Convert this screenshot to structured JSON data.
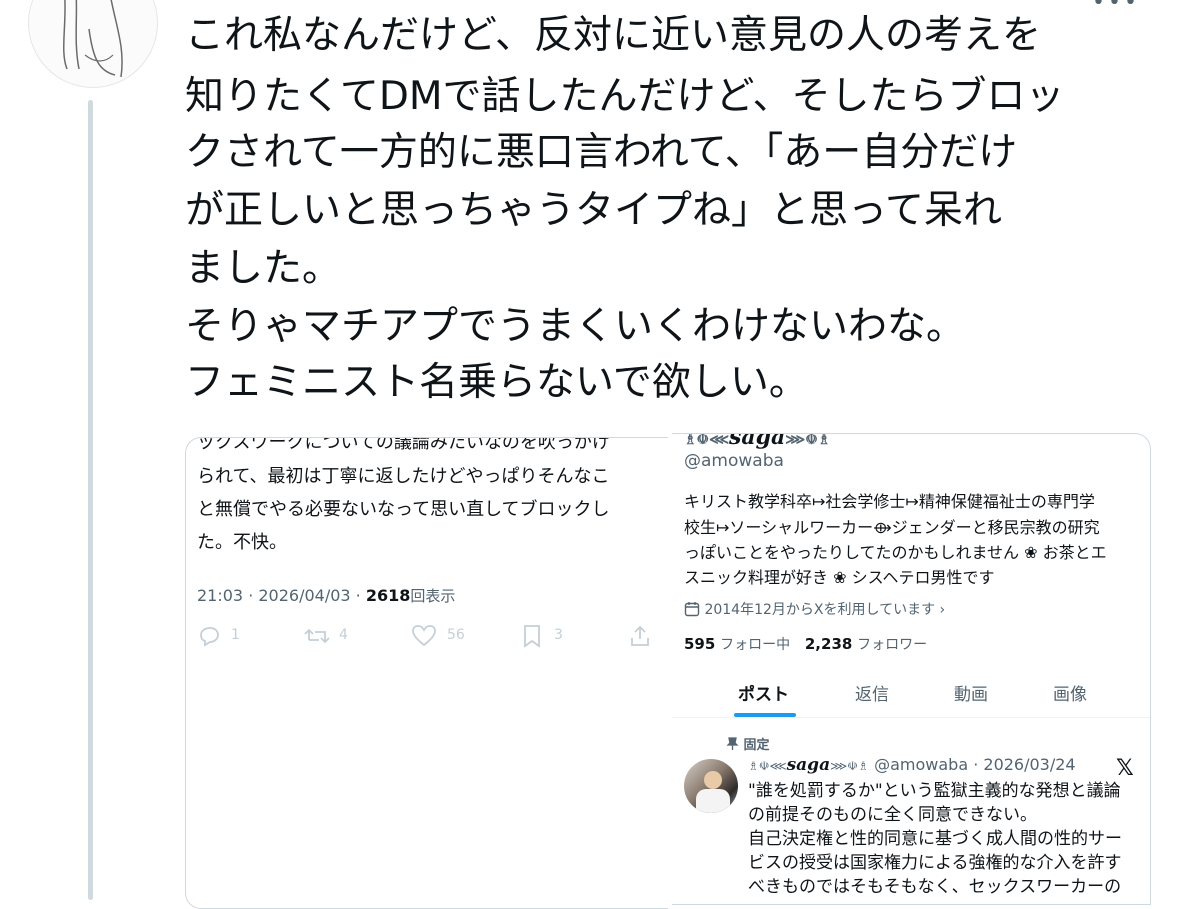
{
  "thread": {
    "more_icon": "more-dots-icon"
  },
  "tweet": {
    "lines": [
      "これ私なんだけど、反対に近い意見の人の考えを",
      "知りたくてDMで話したんだけど、そしたらブロッ",
      "クされて一方的に悪口言われて、「あー自分だけ",
      "が正しいと思っちゃうタイプね」と思って呆れ",
      "ました。",
      "そりゃマチアプでうまくいくわけないわな。",
      "フェミニスト名乗らないで欲しい。"
    ]
  },
  "left_embed": {
    "lines": [
      "ックスワークについての議論みたいなのを吹っかけ",
      "られて、最初は丁寧に返したけどやっぱりそんなこ",
      "と無償でやる必要ないなって思い直してブロックし",
      "た。不快。"
    ],
    "time": "21:03 · 2026/04/03 · ",
    "views_count": "2618",
    "views_label": "回表示",
    "actions": {
      "reply_count": "1",
      "retweet_count": "4",
      "like_count": "56",
      "bookmark_count": "3"
    }
  },
  "right_embed": {
    "display_name": "saga",
    "handle": "@amowaba",
    "bio_lines": [
      "キリスト教学科卒↦社会学修士↦精神保健福祉士の専門学",
      "校生↦ソーシャルワーカー⟴ジェンダーと移民宗教の研究",
      "っぽいことをやったりしてたのかもしれません ❀ お茶とエ",
      "スニック料理が好き ❀ シスヘテロ男性です"
    ],
    "joined": "2014年12月からXを利用しています",
    "following_count": "595",
    "following_label": "フォロー中",
    "followers_count": "2,238",
    "followers_label": "フォロワー",
    "tabs": [
      "ポスト",
      "返信",
      "動画",
      "画像"
    ],
    "pinned_label": "固定",
    "pinned_post": {
      "display_name": "saga",
      "handle_date": "@amowaba · 2026/03/24",
      "lines": [
        "\"誰を処罰するか\"という監獄主義的な発想と議論",
        "の前提そのものに全く同意できない。",
        "自己決定権と性的同意に基づく成人間の性的サー",
        "ビスの授受は国家権力による強権的な介入を許す",
        "べきものではそもそもなく、セックスワーカーの"
      ]
    }
  }
}
